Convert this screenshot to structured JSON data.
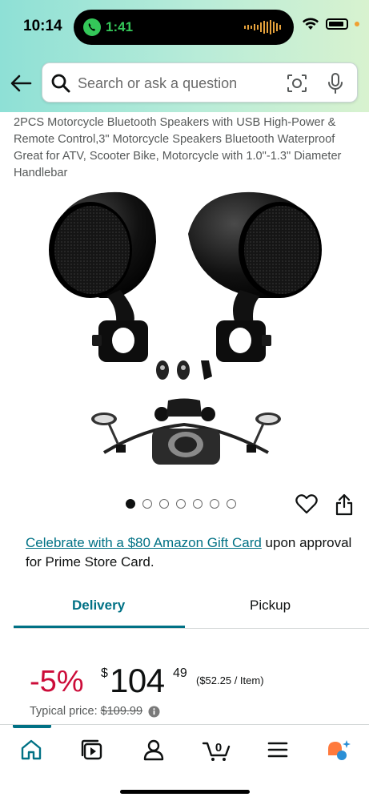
{
  "status_bar": {
    "time": "10:14",
    "call_time": "1:41",
    "call_color": "#34c759"
  },
  "header": {
    "back_icon": "back-arrow-icon",
    "search_placeholder": "Search or ask a question",
    "search_icon": "magnifier-icon",
    "camera_icon": "camera-lens-icon",
    "mic_icon": "microphone-icon"
  },
  "product": {
    "title": "2PCS Motorcycle Bluetooth Speakers with USB High-Power & Remote Control,3\" Motorcycle Speakers Bluetooth Waterproof Great for ATV, Scooter Bike, Motorcycle with 1.0\"-1.3\" Diameter Handlebar",
    "image_count": 7,
    "active_image_index": 0,
    "favorite_icon": "heart-icon",
    "share_icon": "share-icon"
  },
  "promo": {
    "link_text": "Celebrate with a $80 Amazon Gift Card",
    "rest_text": " upon approval for Prime Store Card."
  },
  "tabs": [
    {
      "label": "Delivery",
      "active": true
    },
    {
      "label": "Pickup",
      "active": false
    }
  ],
  "price": {
    "discount": "-5%",
    "currency_symbol": "$",
    "whole": "104",
    "fraction": "49",
    "unit_price": "($52.25 / Item)",
    "typical_label": "Typical price:",
    "typical_value": "$109.99",
    "discount_color": "#cc0c39"
  },
  "bottom_nav": {
    "items": [
      "home-icon",
      "video-icon",
      "account-icon",
      "cart-icon",
      "menu-icon",
      "rufus-icon"
    ],
    "cart_count": "0",
    "accent_color": "#007185"
  }
}
